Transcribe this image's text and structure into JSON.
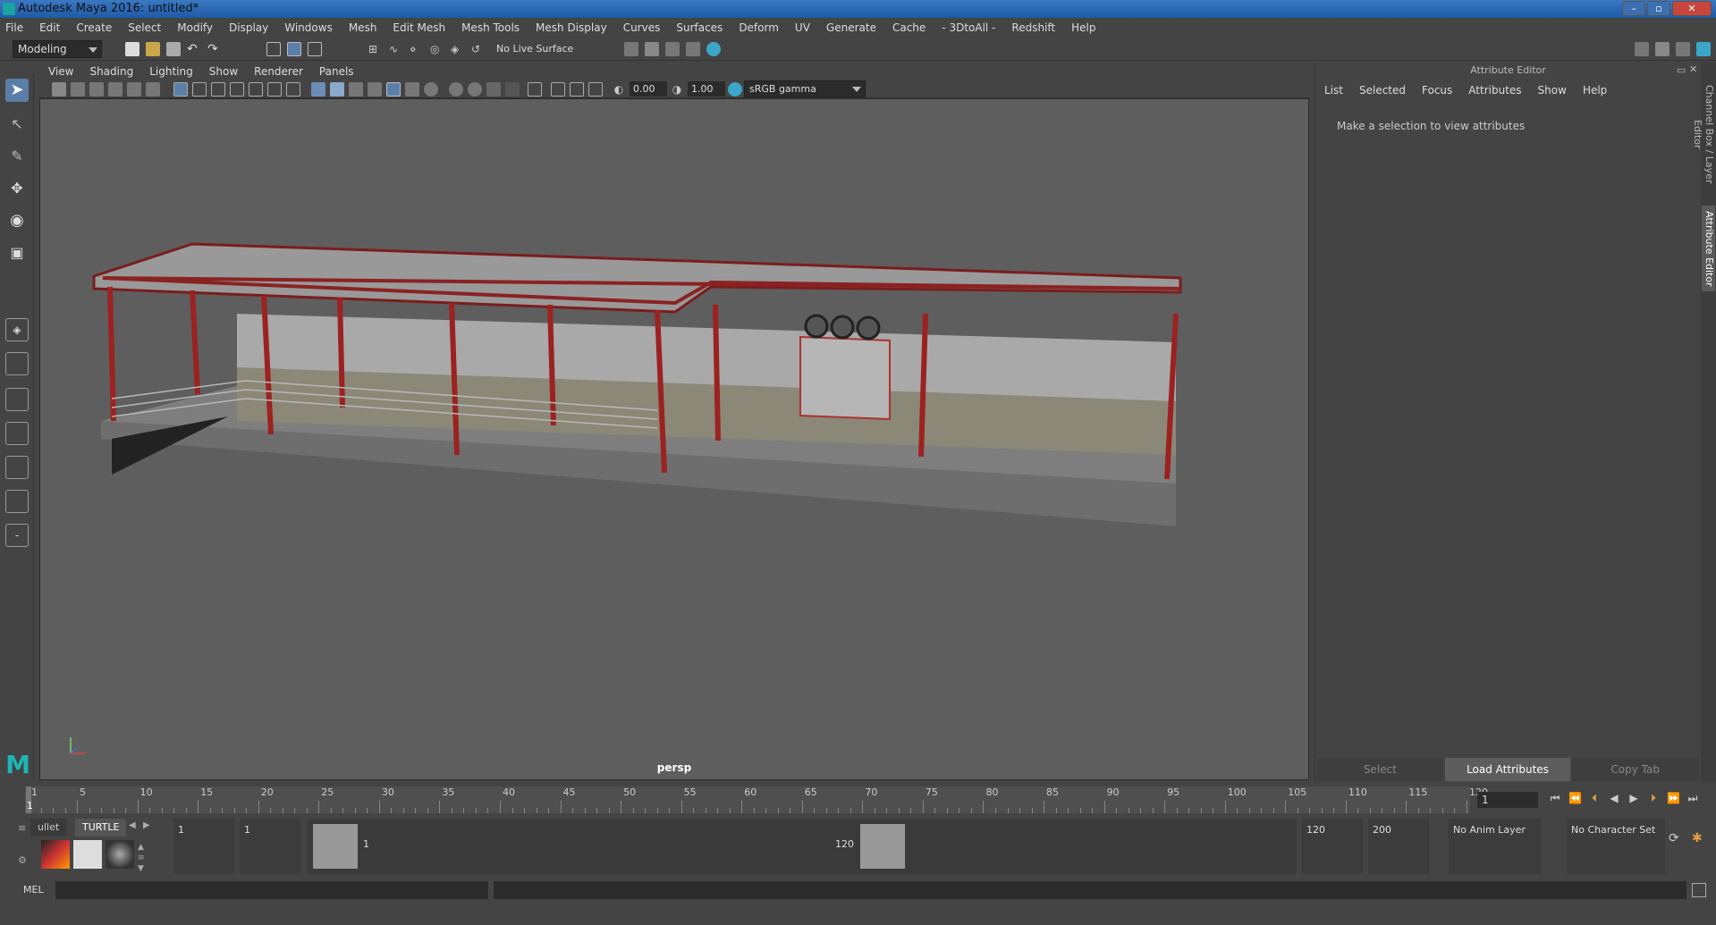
{
  "window": {
    "title": "Autodesk Maya 2016: untitled*"
  },
  "menubar": [
    "File",
    "Edit",
    "Create",
    "Select",
    "Modify",
    "Display",
    "Windows",
    "Mesh",
    "Edit Mesh",
    "Mesh Tools",
    "Mesh Display",
    "Curves",
    "Surfaces",
    "Deform",
    "UV",
    "Generate",
    "Cache",
    "- 3DtoAll -",
    "Redshift",
    "Help"
  ],
  "toolbar": {
    "mode": "Modeling",
    "live_surface": "No Live Surface"
  },
  "panel": {
    "menus": [
      "View",
      "Shading",
      "Lighting",
      "Show",
      "Renderer",
      "Panels"
    ],
    "exposure": "0.00",
    "gamma": "1.00",
    "color_space": "sRGB gamma",
    "camera_label": "persp"
  },
  "attribute_editor": {
    "title": "Attribute Editor",
    "menus": [
      "List",
      "Selected",
      "Focus",
      "Attributes",
      "Show",
      "Help"
    ],
    "message": "Make a selection to view attributes",
    "buttons": {
      "select": "Select",
      "load": "Load Attributes",
      "copy": "Copy Tab"
    }
  },
  "side_tabs": {
    "channel_box": "Channel Box / Layer Editor",
    "attribute_editor": "Attribute Editor"
  },
  "timeline": {
    "ticks": [
      "1",
      "5",
      "10",
      "15",
      "20",
      "25",
      "30",
      "35",
      "40",
      "45",
      "50",
      "55",
      "60",
      "65",
      "70",
      "75",
      "80",
      "85",
      "90",
      "95",
      "100",
      "105",
      "110",
      "115",
      "120"
    ],
    "current_frame": "1",
    "current_time_field": "1"
  },
  "shelf": {
    "tabs": [
      "ullet",
      "TURTLE"
    ]
  },
  "range": {
    "start": "1",
    "playback_start": "1",
    "handle_start": "1",
    "handle_end": "120",
    "playback_end": "120",
    "end": "200",
    "anim_layer": "No Anim Layer",
    "character_set": "No Character Set"
  },
  "command": {
    "language": "MEL"
  }
}
